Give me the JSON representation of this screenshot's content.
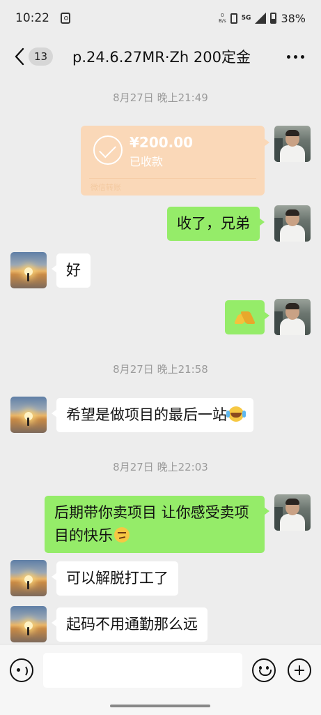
{
  "status_bar": {
    "time": "10:22",
    "net_speed_value": "0",
    "net_speed_unit": "B/s",
    "network": "5G",
    "battery": "38%"
  },
  "header": {
    "unread_count": "13",
    "title": "p.24.6.27MR·Zh 200定金"
  },
  "messages": {
    "ts1": "8月27日 晚上21:49",
    "transfer": {
      "amount": "¥200.00",
      "status": "已收款",
      "footer": "微信转账"
    },
    "m1": "收了，兄弟",
    "m2": "好",
    "ts2": "8月27日 晚上21:58",
    "m4": "希望是做项目的最后一站",
    "ts3": "8月27日 晚上22:03",
    "m5": "后期带你卖项目 让你感受卖项目的快乐",
    "m6": "可以解脱打工了",
    "m7": "起码不用通勤那么远"
  },
  "icons": {
    "back": "chevron-left-icon",
    "more": "more-horizontal-icon",
    "voice": "voice-icon",
    "emoji": "emoji-icon",
    "plus": "plus-icon",
    "check": "check-circle-icon"
  },
  "colors": {
    "outgoing_bubble": "#95ec69",
    "incoming_bubble": "#ffffff",
    "transfer_card": "#fad8b8",
    "background": "#ededed"
  }
}
